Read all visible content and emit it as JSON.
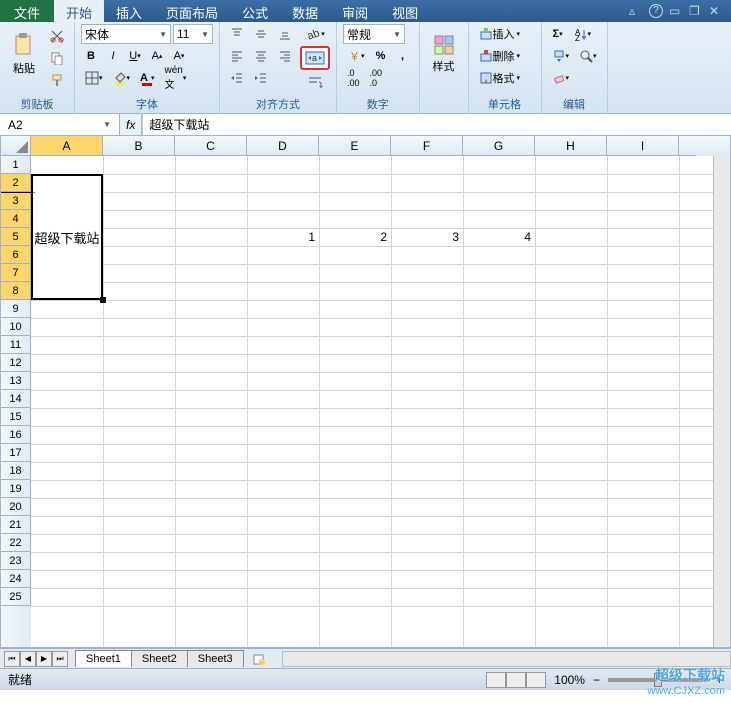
{
  "menu": {
    "file": "文件",
    "tabs": [
      "开始",
      "插入",
      "页面布局",
      "公式",
      "数据",
      "审阅",
      "视图"
    ]
  },
  "ribbon": {
    "clipboard": {
      "paste": "粘贴",
      "label": "剪贴板"
    },
    "font": {
      "name": "宋体",
      "size": "11",
      "label": "字体"
    },
    "align": {
      "label": "对齐方式"
    },
    "number": {
      "format": "常规",
      "label": "数字"
    },
    "styles": {
      "style": "样式",
      "label": ""
    },
    "cells": {
      "insert": "插入",
      "delete": "删除",
      "format": "格式",
      "label": "单元格"
    },
    "edit": {
      "label": "编辑"
    }
  },
  "formula": {
    "cell_ref": "A2",
    "fx": "fx",
    "content": "超级下载站"
  },
  "grid": {
    "cols": [
      "A",
      "B",
      "C",
      "D",
      "E",
      "F",
      "G",
      "H",
      "I"
    ],
    "rows_visible": 25,
    "merged": {
      "text": "超级下载站",
      "top_row": 2,
      "bottom_row": 8,
      "col": 0
    },
    "data": [
      {
        "row": 5,
        "col": 3,
        "v": "1"
      },
      {
        "row": 5,
        "col": 4,
        "v": "2"
      },
      {
        "row": 5,
        "col": 5,
        "v": "3"
      },
      {
        "row": 5,
        "col": 6,
        "v": "4"
      }
    ]
  },
  "tabs": {
    "sheets": [
      "Sheet1",
      "Sheet2",
      "Sheet3"
    ],
    "active": 0
  },
  "status": {
    "ready": "就绪",
    "zoom": "100%"
  },
  "watermark": {
    "l1": "超级下载站",
    "l2": "www.CJXZ.com"
  }
}
